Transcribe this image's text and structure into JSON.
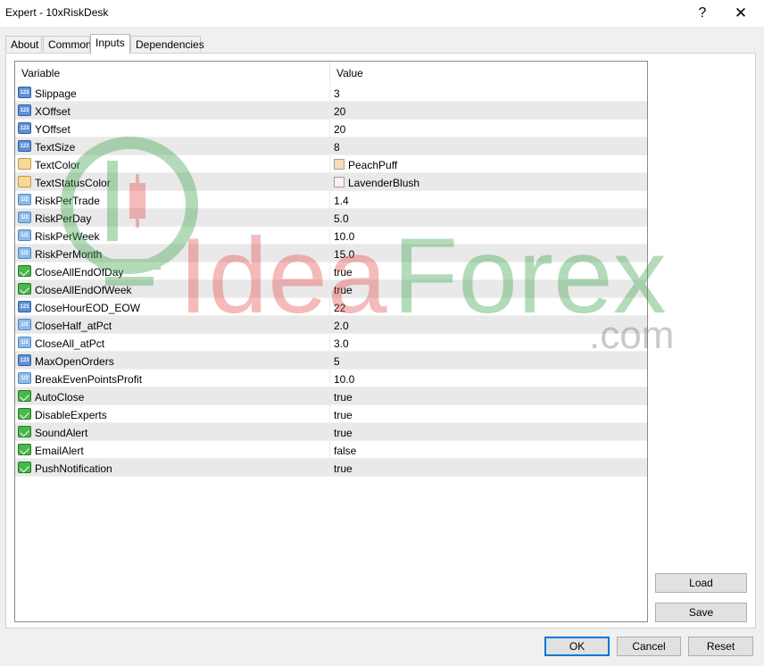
{
  "window": {
    "title": "Expert - 10xRiskDesk",
    "help_label": "?",
    "close_label": "✕"
  },
  "tabs": [
    {
      "label": "About"
    },
    {
      "label": "Common"
    },
    {
      "label": "Inputs",
      "active": true
    },
    {
      "label": "Dependencies"
    }
  ],
  "grid": {
    "headers": {
      "variable": "Variable",
      "value": "Value"
    },
    "rows": [
      {
        "icon": "integer-icon",
        "name": "Slippage",
        "value": "3"
      },
      {
        "icon": "integer-icon",
        "name": "XOffset",
        "value": "20"
      },
      {
        "icon": "integer-icon",
        "name": "YOffset",
        "value": "20"
      },
      {
        "icon": "integer-icon",
        "name": "TextSize",
        "value": "8"
      },
      {
        "icon": "color-icon",
        "name": "TextColor",
        "value": "PeachPuff",
        "swatch": "#ffdab9"
      },
      {
        "icon": "color-icon",
        "name": "TextStatusColor",
        "value": "LavenderBlush",
        "swatch": "#fff0f5"
      },
      {
        "icon": "double-icon",
        "name": "RiskPerTrade",
        "value": "1.4"
      },
      {
        "icon": "double-icon",
        "name": "RiskPerDay",
        "value": "5.0"
      },
      {
        "icon": "double-icon",
        "name": "RiskPerWeek",
        "value": "10.0"
      },
      {
        "icon": "double-icon",
        "name": "RiskPerMonth",
        "value": "15.0"
      },
      {
        "icon": "bool-icon",
        "name": "CloseAllEndOfDay",
        "value": "true"
      },
      {
        "icon": "bool-icon",
        "name": "CloseAllEndOfWeek",
        "value": "true"
      },
      {
        "icon": "integer-icon",
        "name": "CloseHourEOD_EOW",
        "value": "22"
      },
      {
        "icon": "double-icon",
        "name": "CloseHalf_atPct",
        "value": "2.0"
      },
      {
        "icon": "double-icon",
        "name": "CloseAll_atPct",
        "value": "3.0"
      },
      {
        "icon": "integer-icon",
        "name": "MaxOpenOrders",
        "value": "5"
      },
      {
        "icon": "double-icon",
        "name": "BreakEvenPointsProfit",
        "value": "10.0"
      },
      {
        "icon": "bool-icon",
        "name": "AutoClose",
        "value": "true"
      },
      {
        "icon": "bool-icon",
        "name": "DisableExperts",
        "value": "true"
      },
      {
        "icon": "bool-icon",
        "name": "SoundAlert",
        "value": "true"
      },
      {
        "icon": "bool-icon",
        "name": "EmailAlert",
        "value": "false"
      },
      {
        "icon": "bool-icon",
        "name": "PushNotification",
        "value": "true"
      }
    ]
  },
  "side_buttons": {
    "load": "Load",
    "save": "Save"
  },
  "footer_buttons": {
    "ok": "OK",
    "cancel": "Cancel",
    "reset": "Reset"
  },
  "watermark": {
    "text_idea": "Idea",
    "text_forex": "Forex",
    "text_com": ".com",
    "color_green": "#3aa34a",
    "color_red": "#e64b4b"
  },
  "colors": {
    "accent": "#0078d7",
    "alt_row": "#e9e9e9"
  }
}
